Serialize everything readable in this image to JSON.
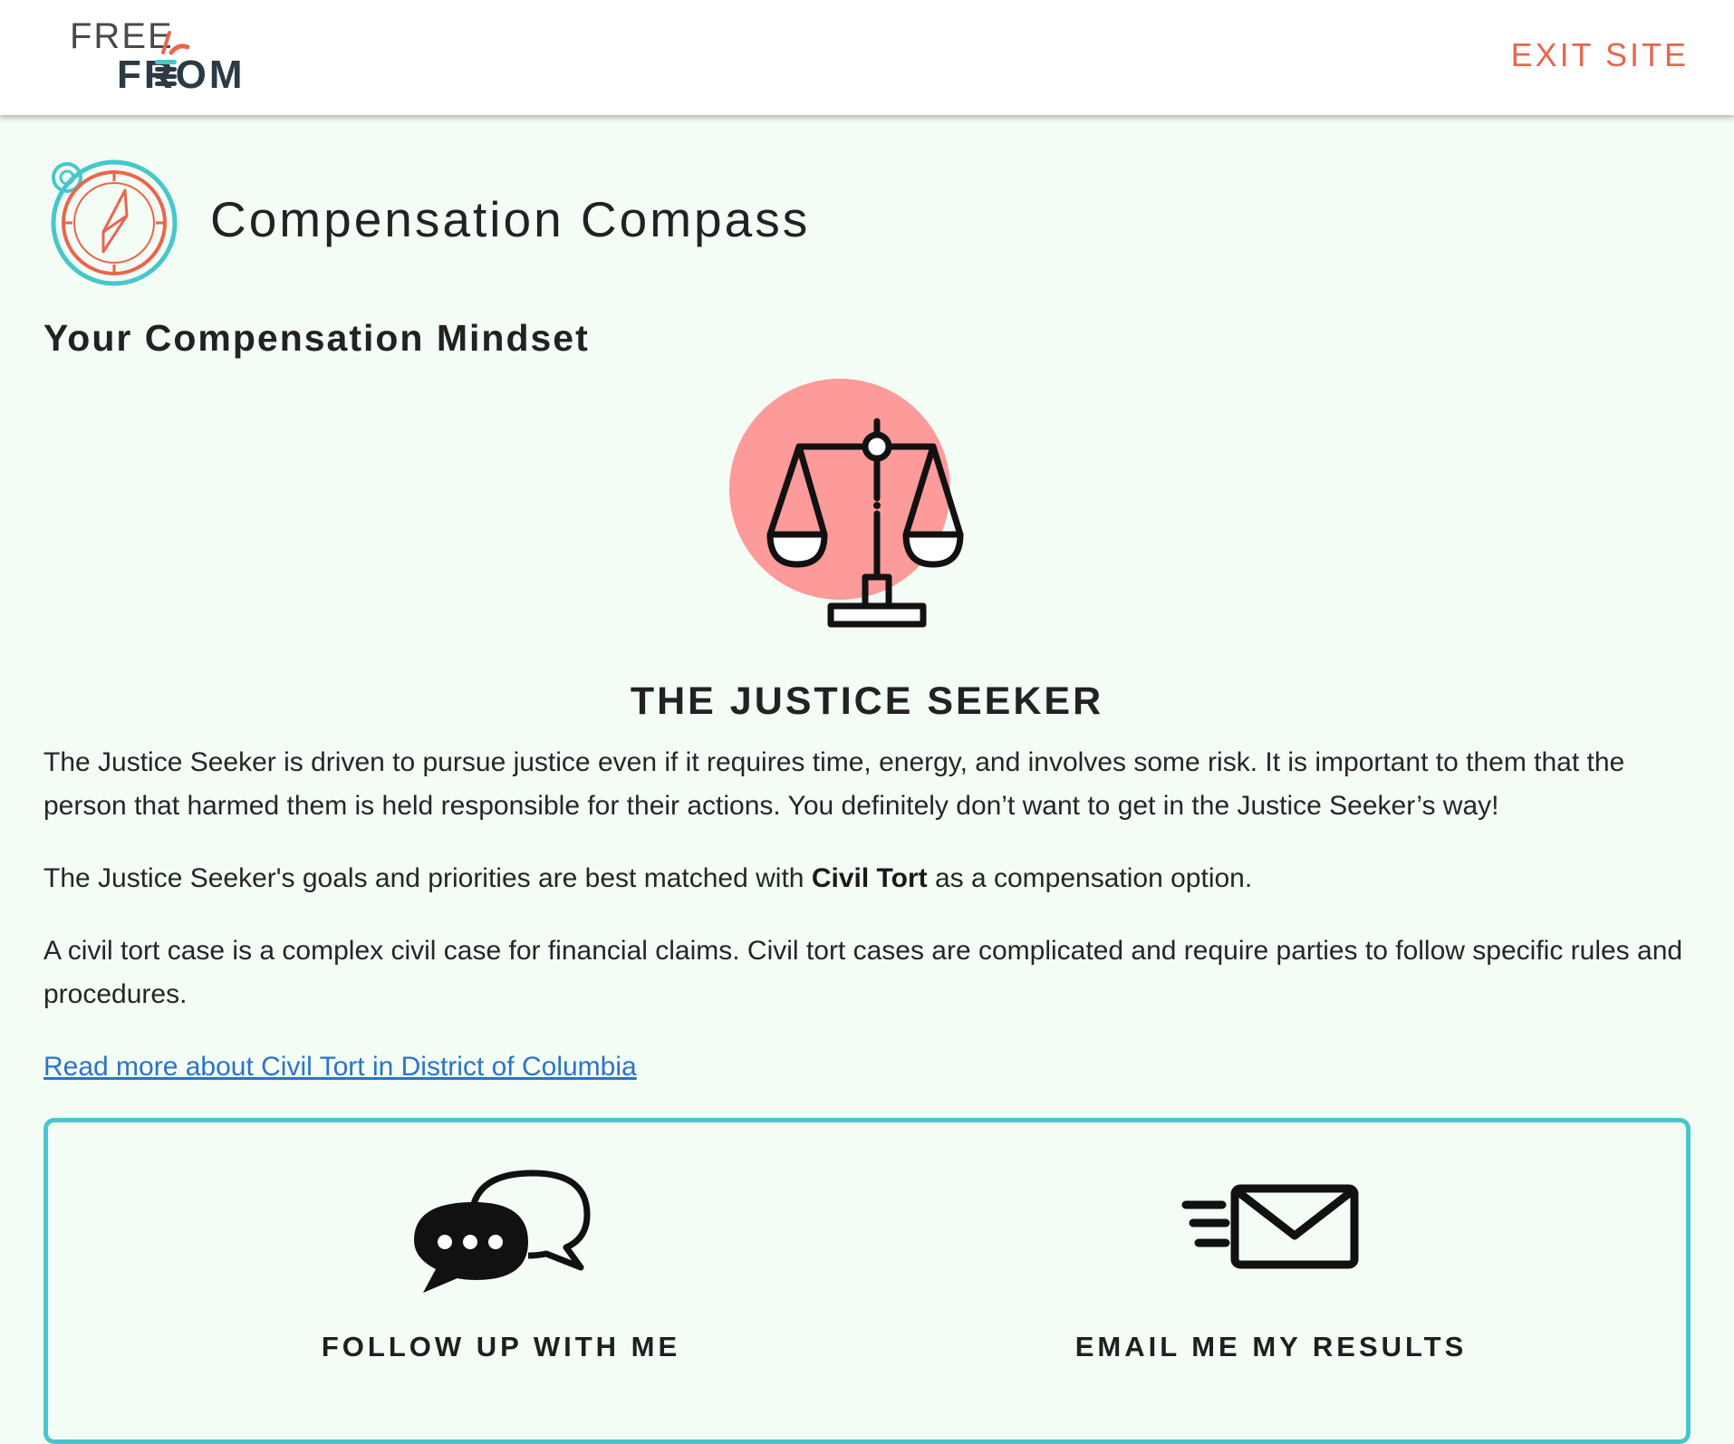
{
  "header": {
    "logo_top": "FREE",
    "logo_bottom": "FROM",
    "exit_label": "EXIT SITE"
  },
  "tool": {
    "title": "Compensation Compass",
    "icon": "compass-icon"
  },
  "result": {
    "heading": "Your Compensation Mindset",
    "illustration": "scales-of-justice-icon",
    "persona_name": "THE JUSTICE SEEKER",
    "description": "The Justice Seeker is driven to pursue justice even if it requires time, energy, and involves some risk. It is important to them that the person that harmed them is held responsible for their actions. You definitely don’t want to get in the Justice Seeker’s way!",
    "match_prefix": "The Justice Seeker's goals and priorities are best matched with",
    "match_option": "Civil Tort",
    "match_suffix": "as a compensation option.",
    "option_description": "A civil tort case is a complex civil case for financial claims. Civil tort cases are complicated and require parties to follow specific rules and procedures.",
    "read_more_label": "Read more about Civil Tort in District of Columbia"
  },
  "actions": {
    "follow_up_label": "FOLLOW UP WITH ME",
    "follow_up_icon": "chat-bubbles-icon",
    "email_label": "EMAIL ME MY RESULTS",
    "email_icon": "envelope-icon"
  },
  "colors": {
    "background": "#f3fcf5",
    "accent_orange": "#e8664d",
    "accent_teal": "#47c7cc",
    "illustration_pink": "#fd9a9a",
    "link_blue": "#2a74c9"
  }
}
